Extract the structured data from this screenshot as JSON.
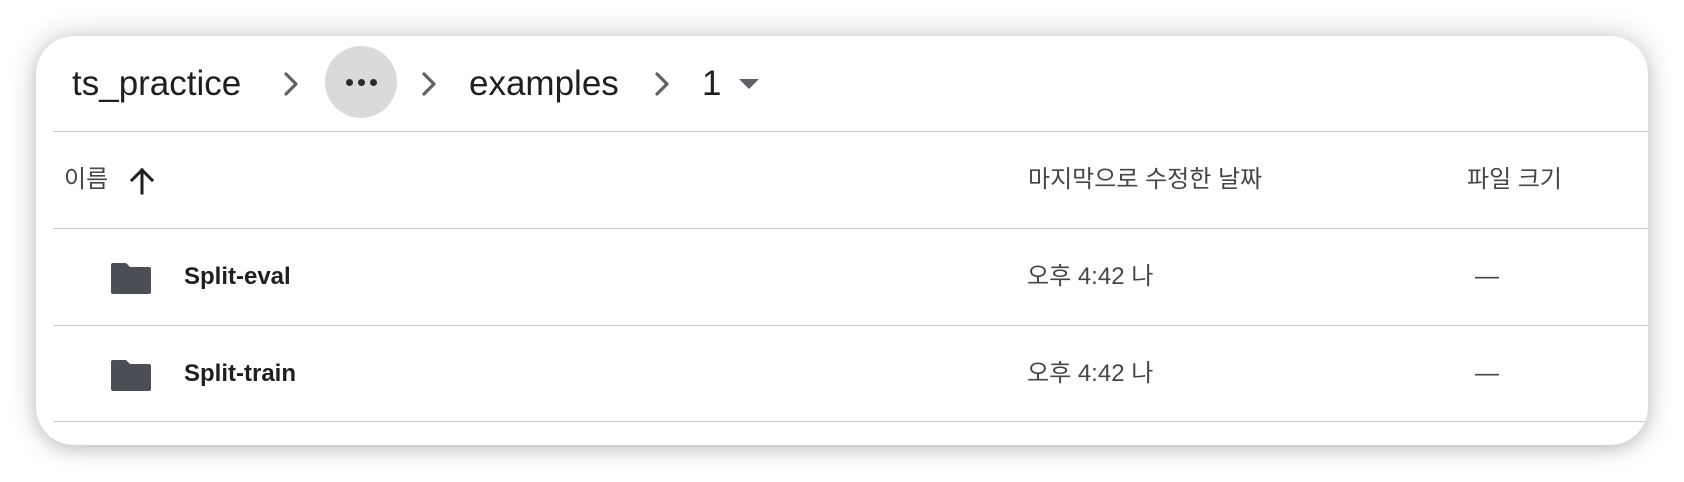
{
  "breadcrumb": {
    "root": "ts_practice",
    "overflow_icon": "more-horiz-icon",
    "folder": "examples",
    "current": "1",
    "separator_icon": "chevron-right-icon",
    "dropdown_icon": "arrow-drop-down-icon"
  },
  "table": {
    "headers": {
      "name": "이름",
      "modified": "마지막으로 수정한 날짜",
      "size": "파일 크기"
    },
    "sort_icon": "arrow-upward-icon",
    "rows": [
      {
        "icon": "folder-icon",
        "name": "Split-eval",
        "modified": "오후 4:42 나",
        "size": "—"
      },
      {
        "icon": "folder-icon",
        "name": "Split-train",
        "modified": "오후 4:42 나",
        "size": "—"
      }
    ]
  },
  "colors": {
    "text_primary": "#1f1f1f",
    "text_secondary": "#444746",
    "divider": "#c8c8c8",
    "folder_icon": "#4b4f55",
    "overflow_button_bg": "#dadada"
  }
}
